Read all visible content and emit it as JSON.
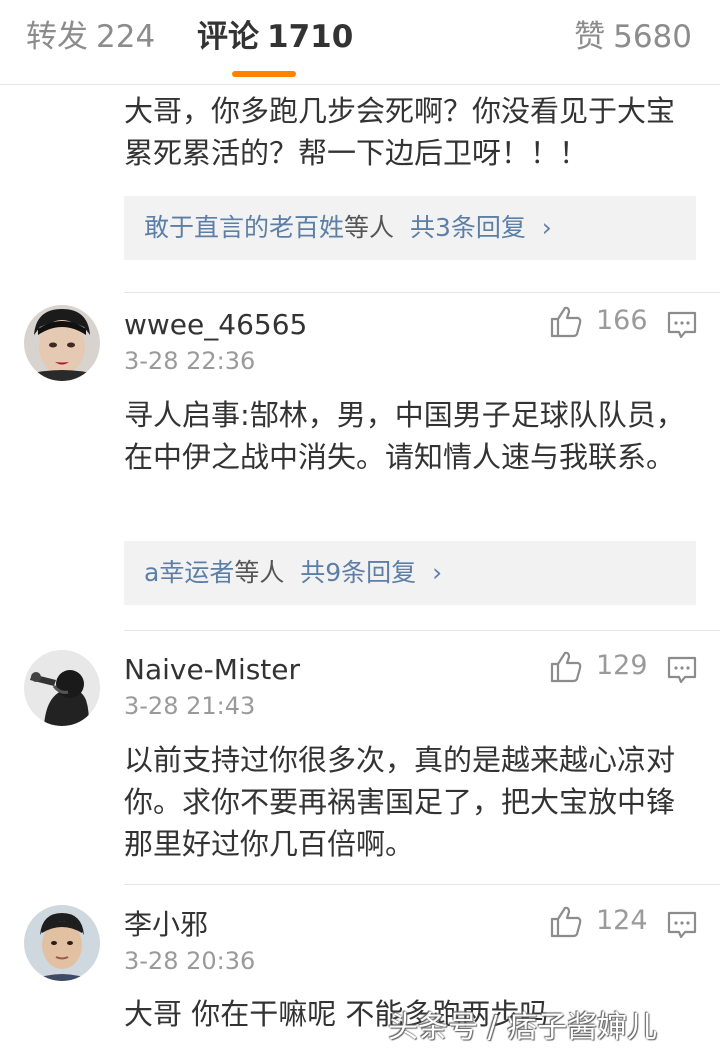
{
  "tabs": {
    "forward": {
      "label": "转发",
      "count": "224"
    },
    "comment": {
      "label": "评论",
      "count": "1710"
    },
    "like": {
      "label": "赞",
      "count": "5680"
    }
  },
  "accent_color": "#ff8200",
  "link_color": "#5d7fa6",
  "comments": [
    {
      "text": "大哥，你多跑几步会死啊？你没看见于大宝累死累活的？帮一下边后卫呀！！！",
      "reply_summary": {
        "names": "敢于直言的老百姓",
        "suffix": "等人",
        "count_text": "共3条回复",
        "chevron": "›"
      }
    },
    {
      "username": "wwee_46565",
      "time": "3-28 22:36",
      "likes": "166",
      "text": "寻人启事:郜林，男，中国男子足球队队员，在中伊之战中消失。请知情人速与我联系。",
      "reply_summary": {
        "names": "a幸运者",
        "suffix": "等人",
        "count_text": "共9条回复",
        "chevron": "›"
      }
    },
    {
      "username": "Naive-Mister",
      "time": "3-28 21:43",
      "likes": "129",
      "text": "以前支持过你很多次，真的是越来越心凉对你。求你不要再祸害国足了，把大宝放中锋那里好过你几百倍啊。"
    },
    {
      "username": "李小邪",
      "time": "3-28 20:36",
      "likes": "124",
      "text": "大哥 你在干嘛呢 不能多跑两步吗"
    }
  ],
  "watermark": "头条号 / 痞子酱婶儿",
  "icons": {
    "like": "thumbs-up-icon",
    "reply": "comment-bubble-icon",
    "chevron": "chevron-right-icon"
  }
}
